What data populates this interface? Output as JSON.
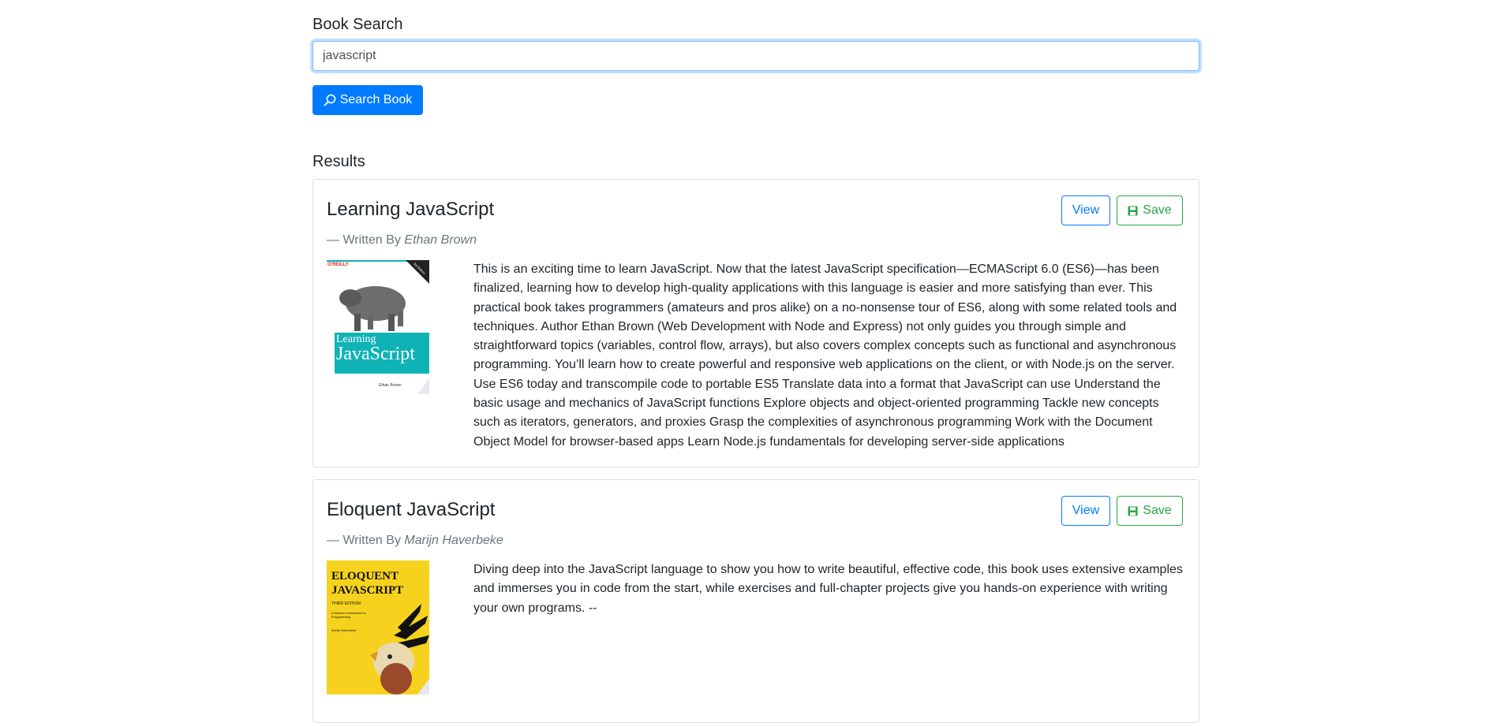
{
  "search": {
    "label": "Book Search",
    "value": "javascript",
    "button_label": "Search Book"
  },
  "results": {
    "heading": "Results",
    "books": [
      {
        "title": "Learning JavaScript",
        "written_by": "— Written By ",
        "author": "Ethan Brown",
        "view_label": "View",
        "save_label": "Save",
        "cover_publisher": "O'REILLY",
        "cover_edition": "3rd Edition",
        "cover_title_line1": "Learning",
        "cover_title_line2": "JavaScript",
        "cover_author": "Ethan Brown",
        "description": "This is an exciting time to learn JavaScript. Now that the latest JavaScript specification—ECMAScript 6.0 (ES6)—has been finalized, learning how to develop high-quality applications with this language is easier and more satisfying than ever. This practical book takes programmers (amateurs and pros alike) on a no-nonsense tour of ES6, along with some related tools and techniques. Author Ethan Brown (Web Development with Node and Express) not only guides you through simple and straightforward topics (variables, control flow, arrays), but also covers complex concepts such as functional and asynchronous programming. You’ll learn how to create powerful and responsive web applications on the client, or with Node.js on the server. Use ES6 today and transcompile code to portable ES5 Translate data into a format that JavaScript can use Understand the basic usage and mechanics of JavaScript functions Explore objects and object-oriented programming Tackle new concepts such as iterators, generators, and proxies Grasp the complexities of asynchronous programming Work with the Document Object Model for browser-based apps Learn Node.js fundamentals for developing server-side applications"
      },
      {
        "title": "Eloquent JavaScript",
        "written_by": "— Written By ",
        "author": "Marijn Haverbeke",
        "view_label": "View",
        "save_label": "Save",
        "cover_title_line1": "ELOQUENT",
        "cover_title_line2": "JAVASCRIPT",
        "cover_edition": "THIRD EDITION",
        "cover_subtitle": "A Modern Introduction to Programming",
        "cover_author": "Marijn Haverbeke",
        "description": "Diving deep into the JavaScript language to show you how to write beautiful, effective code, this book uses extensive examples and immerses you in code from the start, while exercises and full-chapter projects give you hands-on experience with writing your own programs. --"
      }
    ]
  },
  "colors": {
    "primary": "#007bff",
    "success": "#28a745",
    "muted": "#6c757d",
    "card_border": "#dfdfdf",
    "cover1_teal": "#10b3b5",
    "cover2_yellow": "#f6d21e"
  }
}
